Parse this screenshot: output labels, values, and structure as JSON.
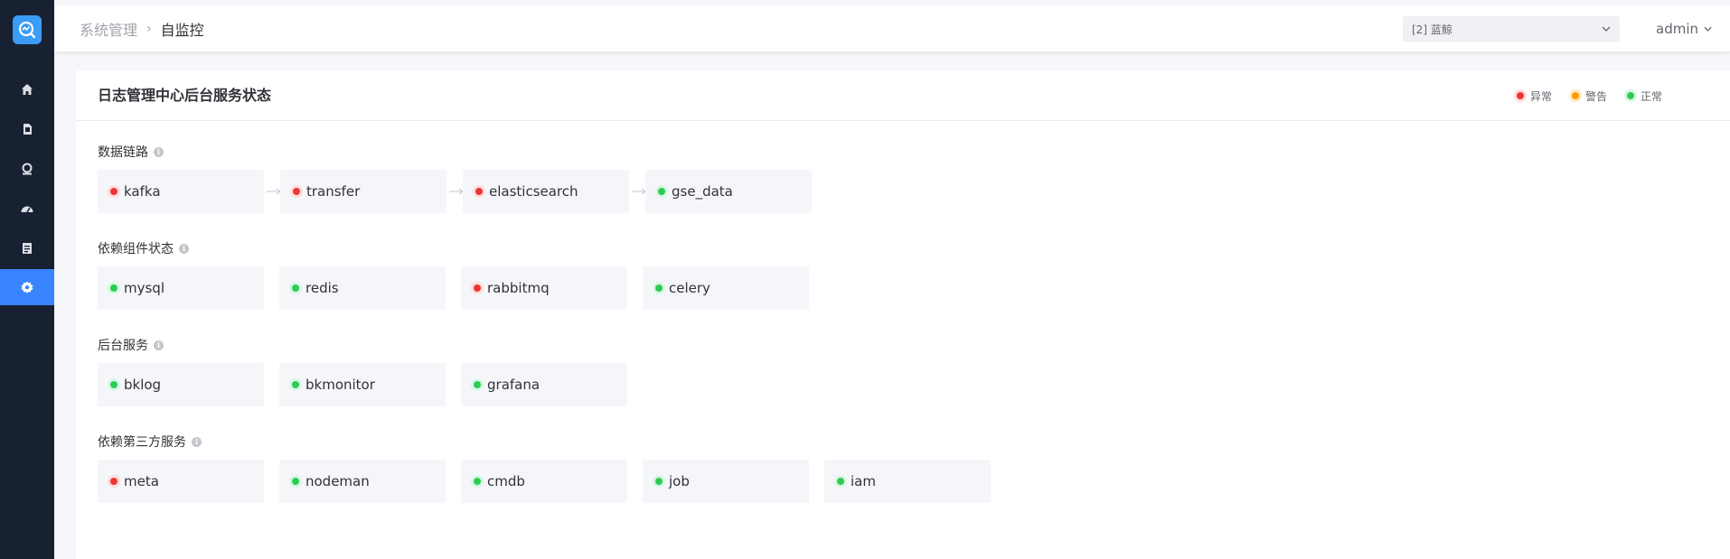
{
  "header": {
    "breadcrumb_parent": "系统管理",
    "breadcrumb_sep": "›",
    "breadcrumb_current": "自监控",
    "business_select": "[2] 蓝鲸",
    "user": "admin"
  },
  "card": {
    "title": "日志管理中心后台服务状态",
    "legend": {
      "error": "异常",
      "warning": "警告",
      "normal": "正常"
    }
  },
  "sections": [
    {
      "title": "数据链路",
      "items": [
        {
          "name": "kafka",
          "status": "error"
        },
        {
          "name": "transfer",
          "status": "error"
        },
        {
          "name": "elasticsearch",
          "status": "error"
        },
        {
          "name": "gse_data",
          "status": "normal"
        }
      ]
    },
    {
      "title": "依赖组件状态",
      "items": [
        {
          "name": "mysql",
          "status": "normal"
        },
        {
          "name": "redis",
          "status": "normal"
        },
        {
          "name": "rabbitmq",
          "status": "error"
        },
        {
          "name": "celery",
          "status": "normal"
        }
      ]
    },
    {
      "title": "后台服务",
      "items": [
        {
          "name": "bklog",
          "status": "normal"
        },
        {
          "name": "bkmonitor",
          "status": "normal"
        },
        {
          "name": "grafana",
          "status": "normal"
        }
      ]
    },
    {
      "title": "依赖第三方服务",
      "items": [
        {
          "name": "meta",
          "status": "error"
        },
        {
          "name": "nodeman",
          "status": "normal"
        },
        {
          "name": "cmdb",
          "status": "normal"
        },
        {
          "name": "job",
          "status": "normal"
        },
        {
          "name": "iam",
          "status": "normal"
        }
      ]
    }
  ],
  "colors": {
    "sidebar": "#182132",
    "accent": "#3a84ff",
    "error": "#ea3636",
    "warning": "#ff9c01",
    "normal": "#2dcb56"
  },
  "sidebar_icons": [
    "home-icon",
    "document-icon",
    "search-icon",
    "dashboard-icon",
    "list-icon",
    "settings-icon"
  ]
}
